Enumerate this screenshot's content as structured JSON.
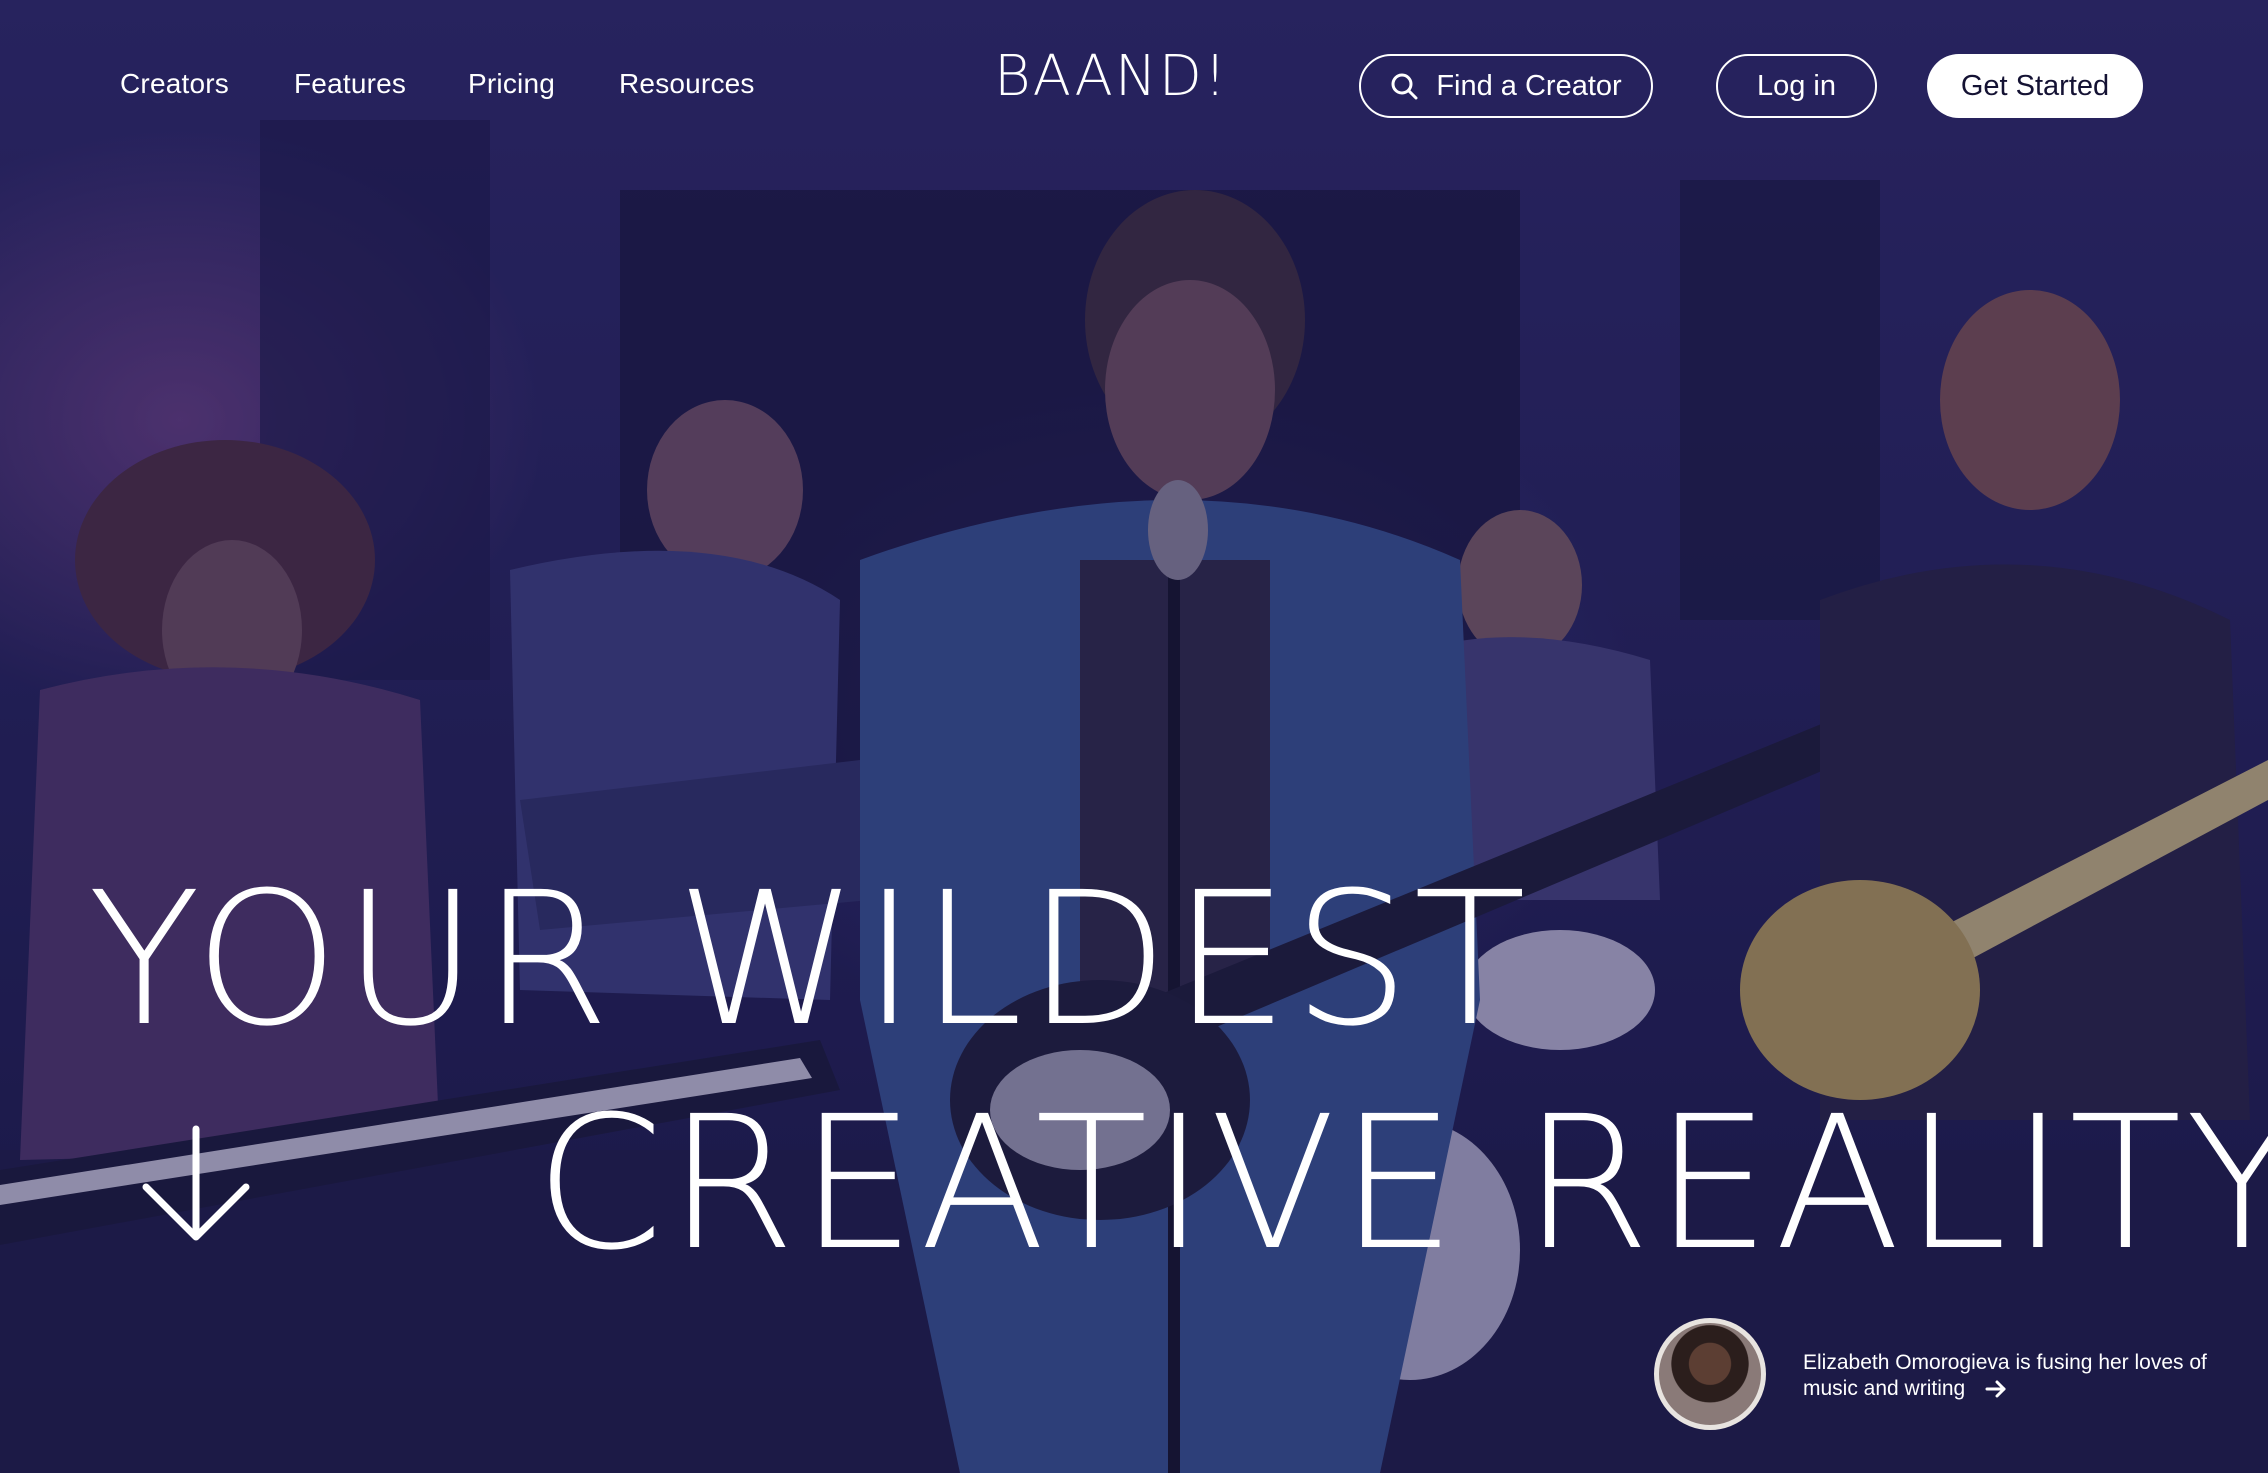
{
  "nav": {
    "links": [
      "Creators",
      "Features",
      "Pricing",
      "Resources"
    ],
    "logo": "BAAND!",
    "search_label": "Find a Creator",
    "login_label": "Log in",
    "cta_label": "Get Started"
  },
  "hero": {
    "headline_line1": "YOUR WILDEST",
    "headline_line2": "CREATIVE REALITY",
    "scroll_icon": "arrow-down-icon",
    "background_image": "band performing on stage"
  },
  "featured_creator": {
    "text": "Elizabeth Omorogieva is fusing her loves of music and writing",
    "link_icon": "arrow-right-icon"
  },
  "colors": {
    "overlay": "#221f55",
    "text": "#ffffff",
    "cta_bg": "#ffffff",
    "cta_text": "#141233"
  }
}
